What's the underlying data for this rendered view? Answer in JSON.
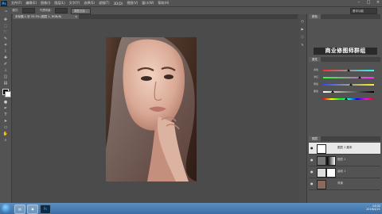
{
  "app": {
    "logo": "Ps",
    "name": "Adobe Photoshop"
  },
  "menubar": {
    "items": [
      "文件(F)",
      "编辑(E)",
      "图像(I)",
      "图层(L)",
      "文字(Y)",
      "选择(S)",
      "滤镜(T)",
      "3D(D)",
      "视图(V)",
      "窗口(W)",
      "帮助(H)"
    ],
    "window_controls": [
      "–",
      "□",
      "×"
    ]
  },
  "options_bar": {
    "label_mode": "模式:",
    "label_opacity": "不透明度:",
    "button_refine": "调整边缘...",
    "workspace": "基本功能"
  },
  "document_tab": {
    "title": "未标题-1 @ 33.3% (图层 1, RGB/8)",
    "close": "×"
  },
  "panels": {
    "top_tab": "颜色",
    "adjust_tab": "属性",
    "layers_tab": "图层"
  },
  "watermark": "商业修图师群组",
  "sliders": [
    {
      "label": "青色",
      "value": 0.5
    },
    {
      "label": "洋红",
      "value": 0.72
    },
    {
      "label": "黄色",
      "value": 0.55
    },
    {
      "label": "黑色",
      "value": 0.18
    },
    {
      "label": "",
      "value": 0.45
    }
  ],
  "layers": [
    {
      "name": "图层 1 副本",
      "selected": true
    },
    {
      "name": "图层 1",
      "selected": false
    },
    {
      "name": "曲线 1",
      "selected": false
    },
    {
      "name": "背景",
      "selected": false
    }
  ],
  "taskbar": {
    "clock_time": "14:02",
    "clock_date": "2016/4/21"
  },
  "colors": {
    "accent": "#31a8ff",
    "panel": "#535353",
    "canvas": "#4b4b4b",
    "taskbar": "#3a6ea5"
  }
}
